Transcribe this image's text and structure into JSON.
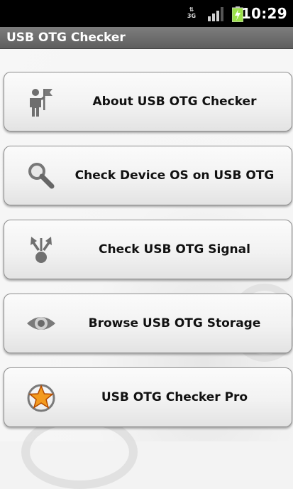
{
  "status_bar": {
    "network_type": "3G",
    "time": "10:29"
  },
  "app": {
    "title": "USB OTG Checker"
  },
  "menu": [
    {
      "label": "About USB OTG Checker",
      "icon": "person-flag-icon"
    },
    {
      "label": "Check Device OS on USB OTG",
      "icon": "magnifier-icon"
    },
    {
      "label": "Check USB OTG Signal",
      "icon": "usb-signal-icon"
    },
    {
      "label": "Browse USB OTG Storage",
      "icon": "eye-icon"
    },
    {
      "label": "USB OTG Checker Pro",
      "icon": "star-icon"
    }
  ],
  "colors": {
    "title_bar": "#6e6e6e",
    "status_bar": "#000000",
    "battery_green": "#9be04a",
    "star_orange": "#f39a1e"
  }
}
